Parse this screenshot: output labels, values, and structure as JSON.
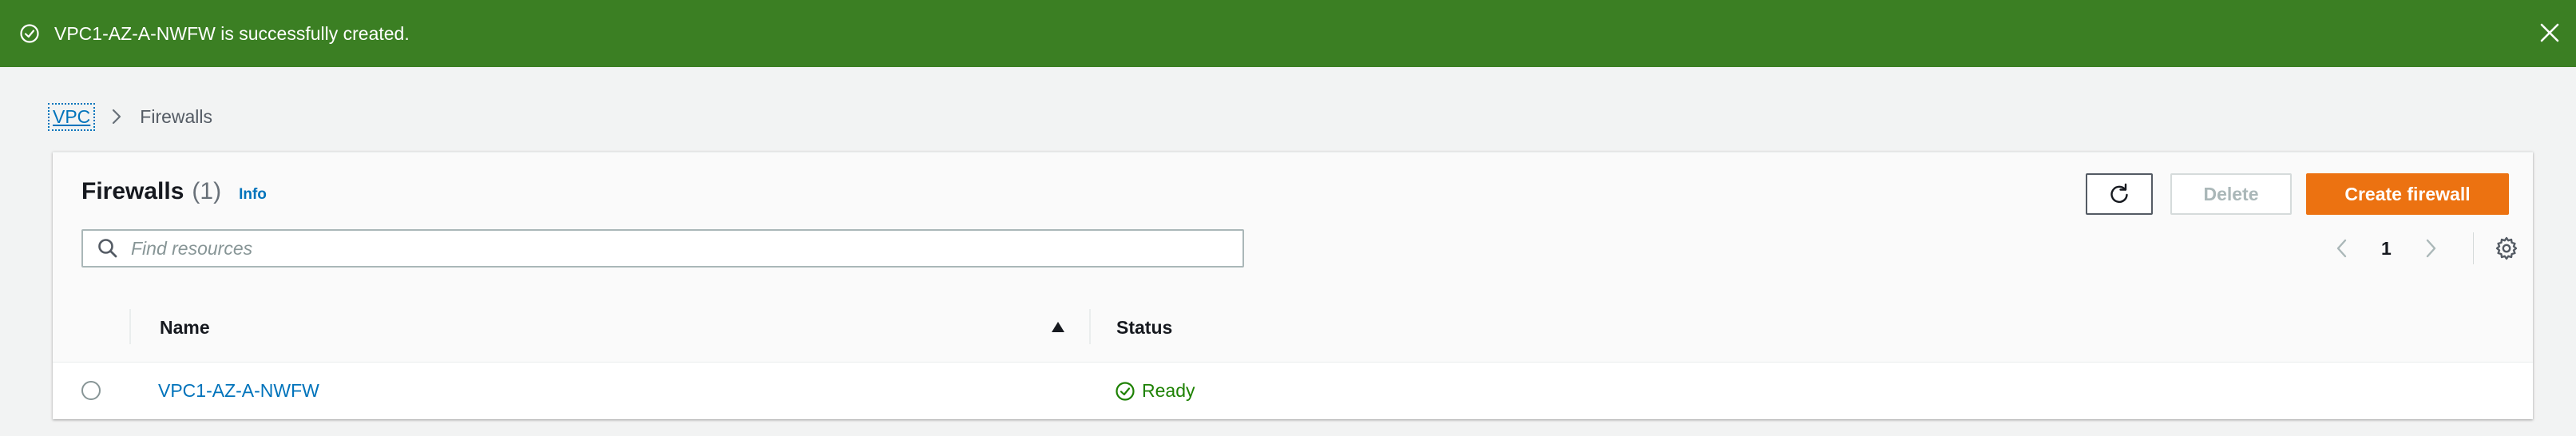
{
  "flash": {
    "message": "VPC1-AZ-A-NWFW is successfully created.",
    "color": "#3b7f23"
  },
  "breadcrumb": {
    "root": "VPC",
    "current": "Firewalls"
  },
  "panel": {
    "title": "Firewalls",
    "count": "(1)",
    "info_label": "Info"
  },
  "toolbar": {
    "refresh_icon": "refresh-icon",
    "delete_label": "Delete",
    "create_label": "Create firewall",
    "create_color": "#ec7211"
  },
  "search": {
    "value": "",
    "placeholder": "Find resources"
  },
  "pagination": {
    "current_page": "1"
  },
  "table": {
    "columns": [
      "Name",
      "Status"
    ],
    "sort_indicator": "sort-ascending-icon",
    "rows": [
      {
        "name": "VPC1-AZ-A-NWFW",
        "status": "Ready",
        "status_color": "#1d8102",
        "selected": false
      }
    ]
  }
}
